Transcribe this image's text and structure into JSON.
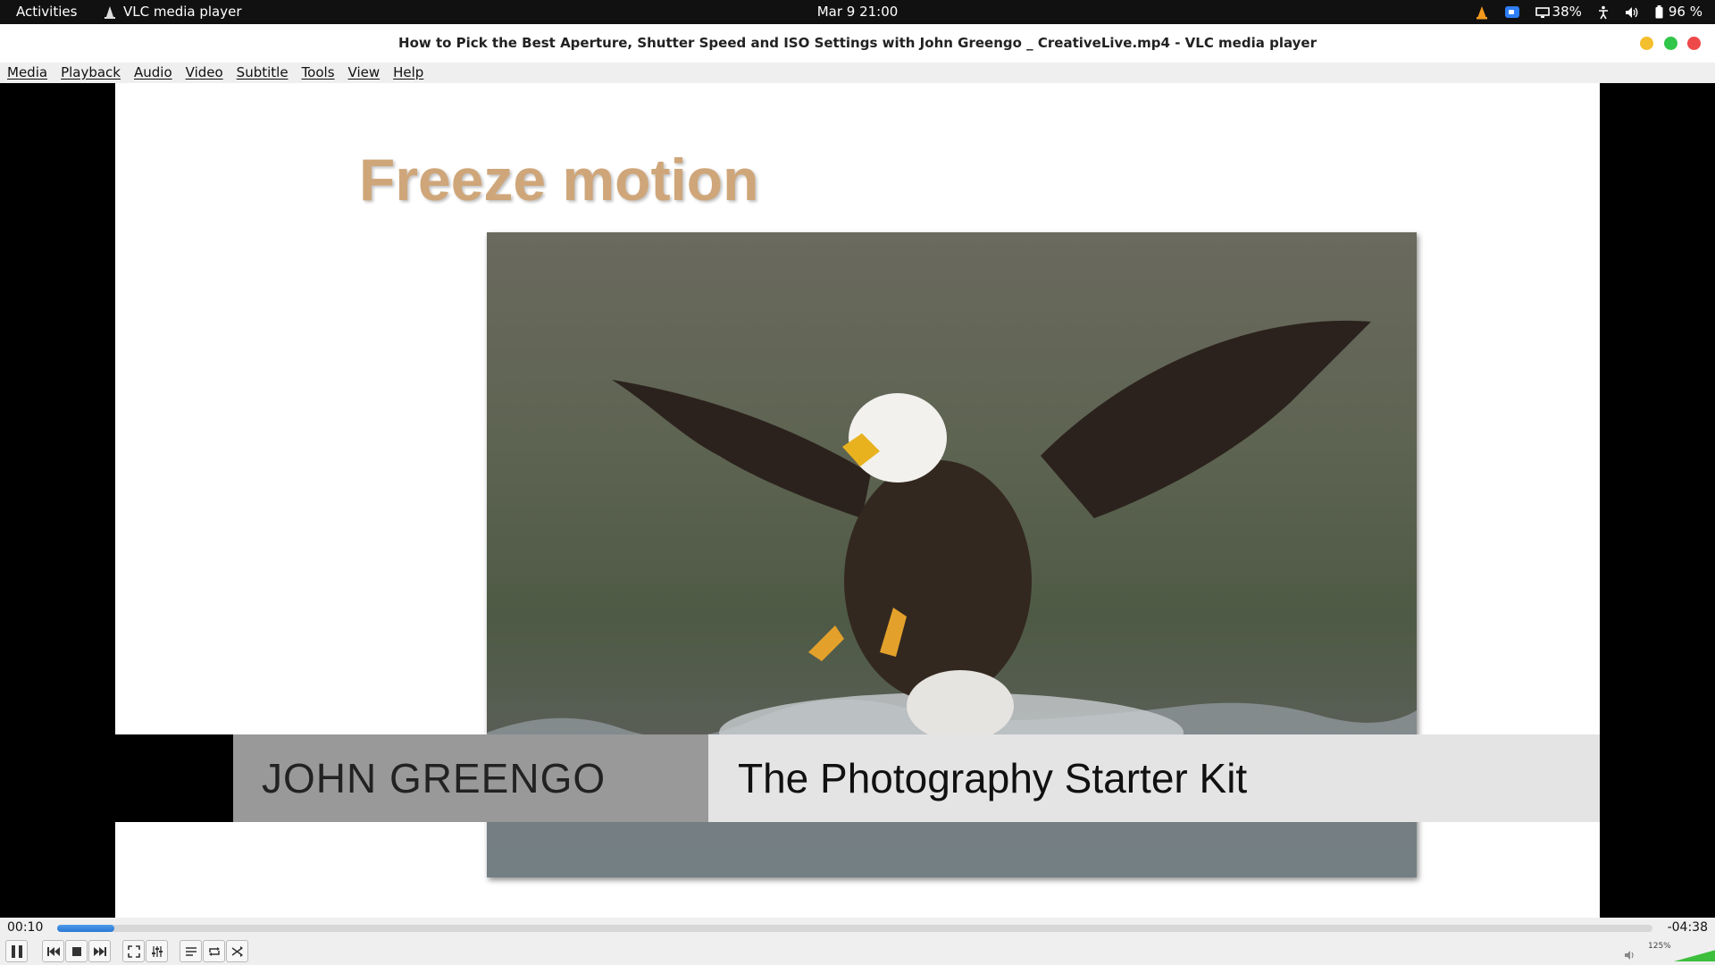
{
  "topbar": {
    "activities": "Activities",
    "app_name": "VLC media player",
    "clock": "Mar 9  21:00",
    "screen_percent": "38%",
    "battery": "96 %"
  },
  "window": {
    "title": "How to Pick the Best Aperture, Shutter Speed and ISO Settings with John Greengo _ CreativeLive.mp4 - VLC media player"
  },
  "menu": [
    "Media",
    "Playback",
    "Audio",
    "Video",
    "Subtitle",
    "Tools",
    "View",
    "Help"
  ],
  "video": {
    "slide_title": "Freeze motion",
    "lower_third_name": "JOHN GREENGO",
    "lower_third_title": "The Photography Starter Kit"
  },
  "controls": {
    "elapsed": "00:10",
    "remaining": "-04:38",
    "progress_fraction": 0.036,
    "volume_label": "125%"
  },
  "colors": {
    "accent": "#2a78d6",
    "slide_title": "#cfa679",
    "volume_green": "#3cbf3c"
  }
}
